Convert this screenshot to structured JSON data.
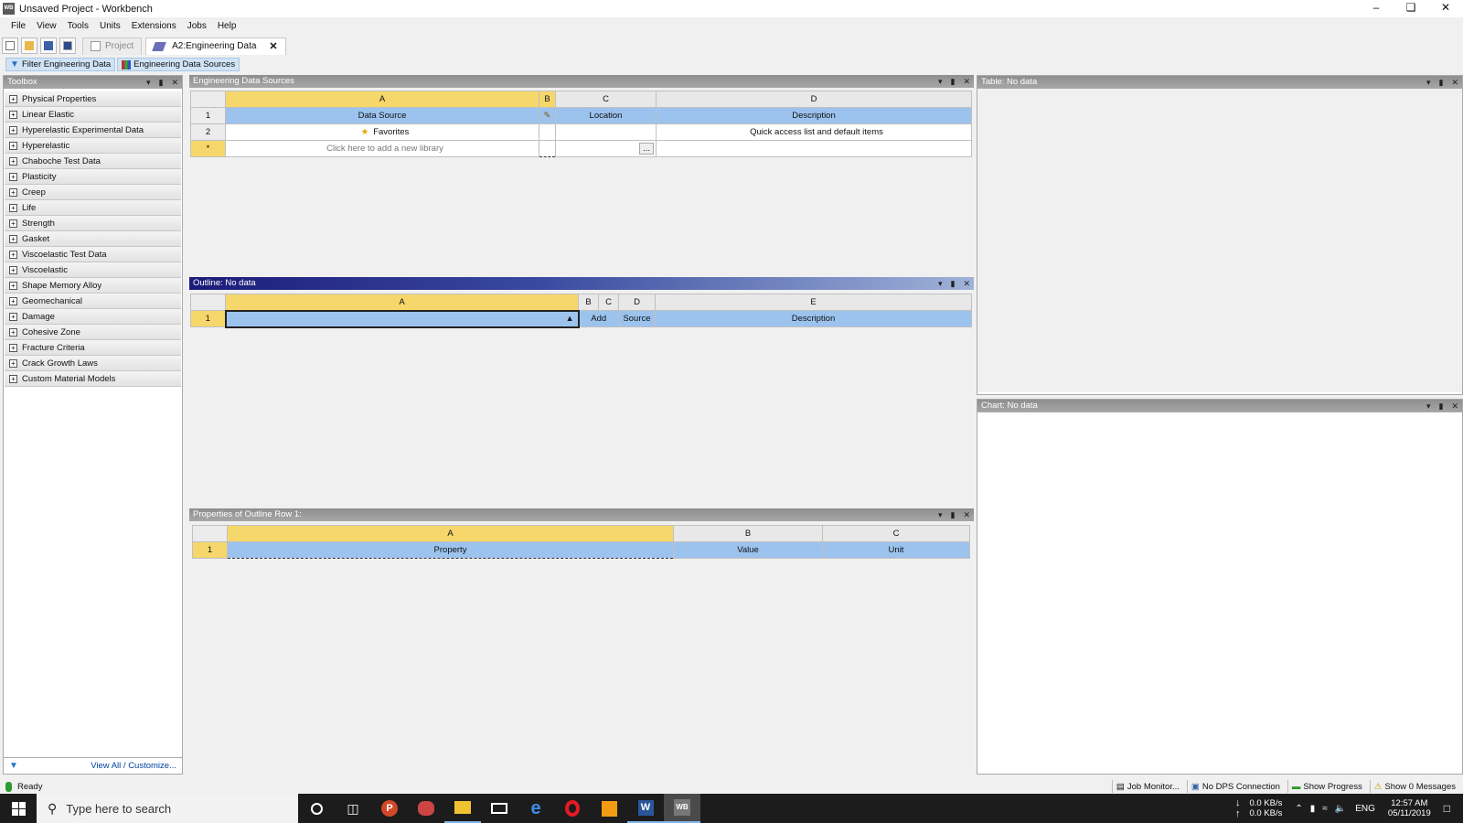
{
  "window": {
    "title": "Unsaved Project - Workbench",
    "app_icon_text": "WB"
  },
  "menu": [
    "File",
    "View",
    "Tools",
    "Units",
    "Extensions",
    "Jobs",
    "Help"
  ],
  "tabs": [
    {
      "label": "Project",
      "state": "inactive"
    },
    {
      "label": "A2:Engineering Data",
      "state": "active"
    }
  ],
  "subtoolbar": {
    "filter_label": "Filter Engineering Data",
    "sources_label": "Engineering Data Sources"
  },
  "toolbox": {
    "title": "Toolbox",
    "items": [
      "Physical Properties",
      "Linear Elastic",
      "Hyperelastic Experimental Data",
      "Hyperelastic",
      "Chaboche Test Data",
      "Plasticity",
      "Creep",
      "Life",
      "Strength",
      "Gasket",
      "Viscoelastic Test Data",
      "Viscoelastic",
      "Shape Memory Alloy",
      "Geomechanical",
      "Damage",
      "Cohesive Zone",
      "Fracture Criteria",
      "Crack Growth Laws",
      "Custom Material Models"
    ],
    "footer_link": "View All / Customize..."
  },
  "sources_panel": {
    "title": "Engineering Data Sources",
    "columns": [
      "A",
      "B",
      "C",
      "D"
    ],
    "row1": {
      "num": "1",
      "a": "Data Source",
      "c": "Location",
      "d": "Description"
    },
    "row2": {
      "num": "2",
      "a": "Favorites",
      "d": "Quick access list and default items"
    },
    "row3": {
      "num": "*",
      "a": "Click here to add a new library",
      "c": "..."
    }
  },
  "outline_panel": {
    "title": "Outline: No data",
    "columns": [
      "A",
      "B",
      "C",
      "D",
      "E"
    ],
    "row1": {
      "num": "1",
      "c": "Add",
      "d": "Source",
      "e": "Description"
    }
  },
  "properties_panel": {
    "title": "Properties of Outline Row 1:",
    "columns": [
      "A",
      "B",
      "C"
    ],
    "row1": {
      "num": "1",
      "a": "Property",
      "b": "Value",
      "c": "Unit"
    }
  },
  "table_panel": {
    "title": "Table: No data"
  },
  "chart_panel": {
    "title": "Chart: No data"
  },
  "status": {
    "text": "Ready",
    "buttons": [
      "Job Monitor...",
      "No DPS Connection",
      "Show Progress",
      "Show 0 Messages"
    ]
  },
  "taskbar": {
    "search_placeholder": "Type here to search",
    "net_down": "0.0 KB/s",
    "net_up": "0.0 KB/s",
    "lang": "ENG",
    "time": "12:57 AM",
    "date": "05/11/2019"
  }
}
